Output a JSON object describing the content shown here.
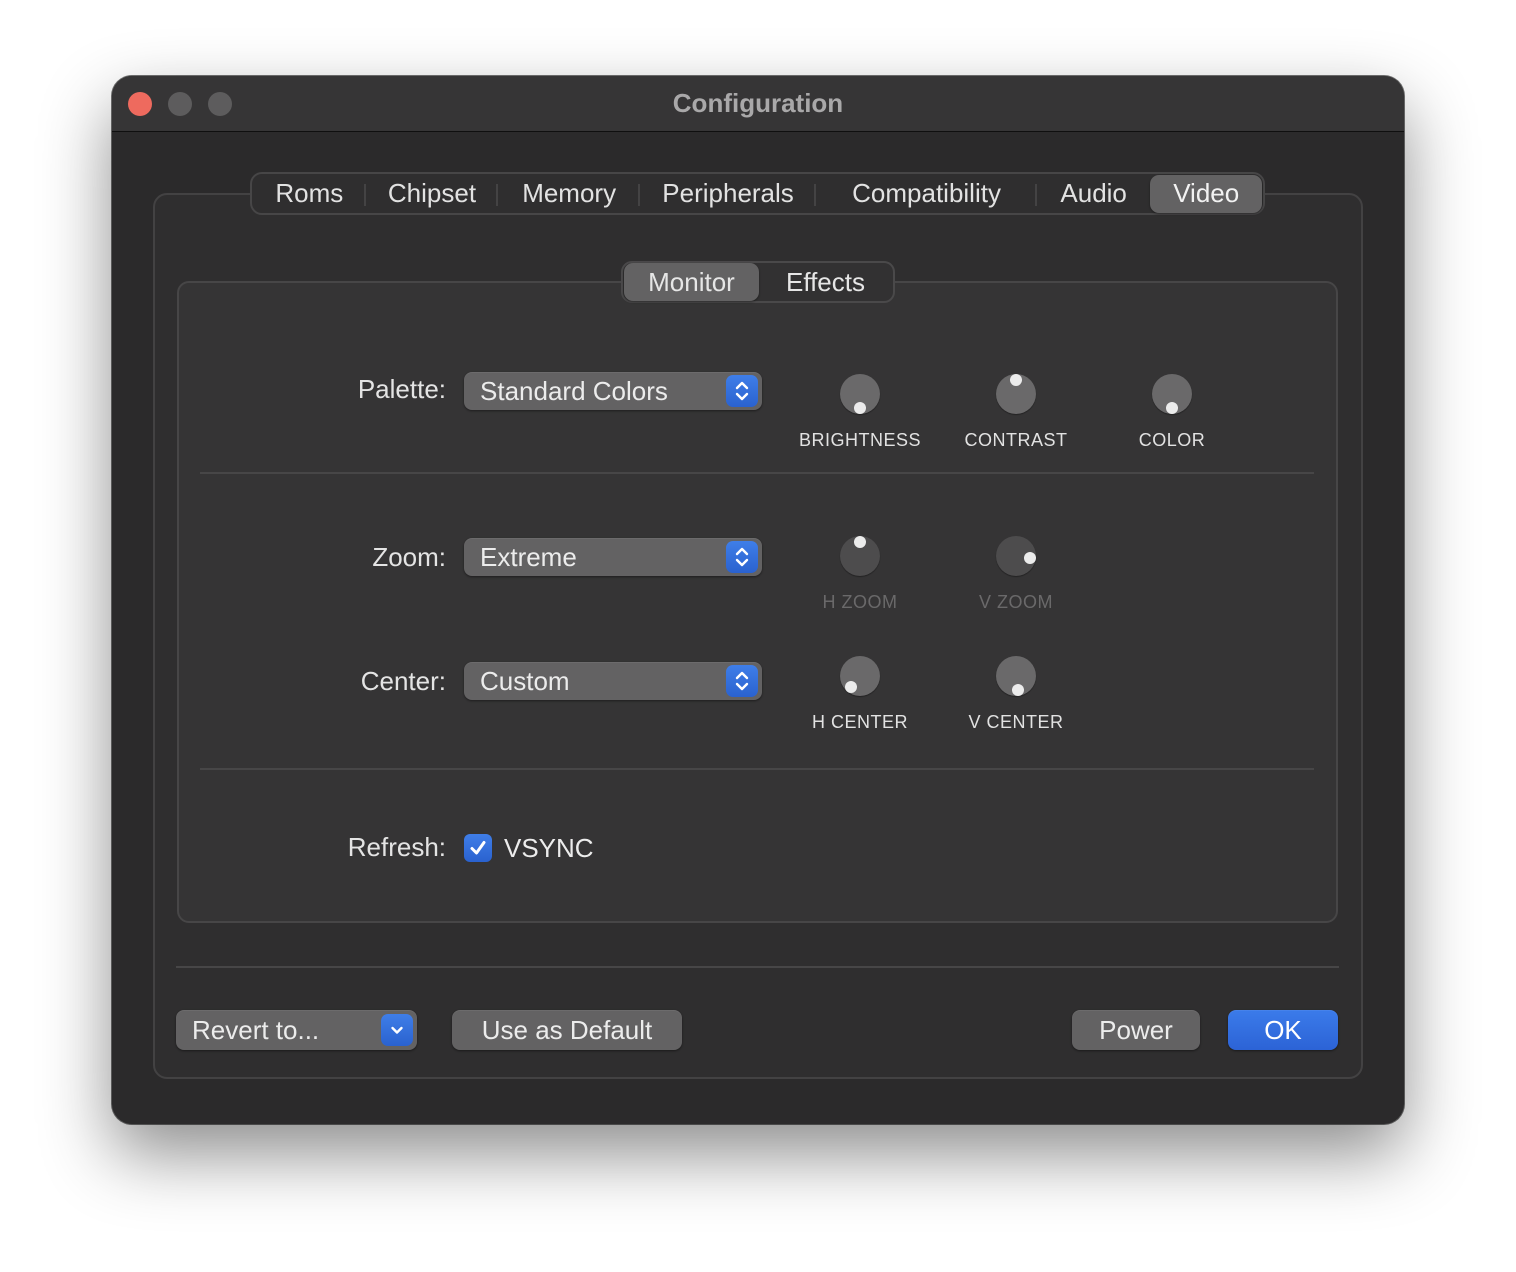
{
  "window": {
    "title": "Configuration"
  },
  "tabs": [
    {
      "label": "Roms",
      "active": false
    },
    {
      "label": "Chipset",
      "active": false
    },
    {
      "label": "Memory",
      "active": false
    },
    {
      "label": "Peripherals",
      "active": false
    },
    {
      "label": "Compatibility",
      "active": false
    },
    {
      "label": "Audio",
      "active": false
    },
    {
      "label": "Video",
      "active": true
    }
  ],
  "subtabs": [
    {
      "label": "Monitor",
      "active": true
    },
    {
      "label": "Effects",
      "active": false
    }
  ],
  "palette": {
    "label": "Palette:",
    "value": "Standard Colors"
  },
  "zoom": {
    "label": "Zoom:",
    "value": "Extreme"
  },
  "center": {
    "label": "Center:",
    "value": "Custom"
  },
  "refresh": {
    "label": "Refresh:",
    "checkbox_label": "VSYNC",
    "checked": true
  },
  "knobs": {
    "brightness": {
      "label": "BRIGHTNESS",
      "enabled": true,
      "angle_deg": 180
    },
    "contrast": {
      "label": "CONTRAST",
      "enabled": true,
      "angle_deg": 0
    },
    "color": {
      "label": "COLOR",
      "enabled": true,
      "angle_deg": 180
    },
    "h_zoom": {
      "label": "H ZOOM",
      "enabled": false,
      "angle_deg": 0
    },
    "v_zoom": {
      "label": "V ZOOM",
      "enabled": false,
      "angle_deg": 100
    },
    "h_center": {
      "label": "H CENTER",
      "enabled": true,
      "angle_deg": 220
    },
    "v_center": {
      "label": "V CENTER",
      "enabled": true,
      "angle_deg": 170
    }
  },
  "buttons": {
    "revert": "Revert to...",
    "use_default": "Use as Default",
    "power": "Power",
    "ok": "OK"
  },
  "colors": {
    "accent": "#2c63d6",
    "close": "#ee6a5e"
  }
}
